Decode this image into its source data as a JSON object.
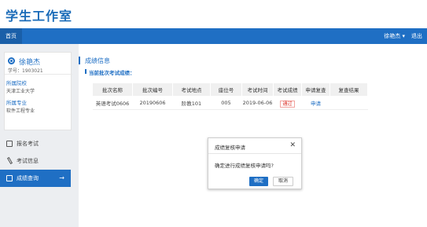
{
  "app": {
    "title": "学生工作室"
  },
  "nav": {
    "home": "首页",
    "user": "徐艳杰 ▾",
    "logout": "退出"
  },
  "profile": {
    "name": "徐艳杰",
    "student_id": "学号：1903021",
    "school_label": "所属院校",
    "school": "天津工业大学",
    "major_label": "所属专业",
    "major": "软件工程专业"
  },
  "menu": [
    {
      "label": "报名考试",
      "icon": "register-icon"
    },
    {
      "label": "考试信息",
      "icon": "edit-icon"
    },
    {
      "label": "成绩查询",
      "icon": "query-icon",
      "arrow": "→"
    }
  ],
  "main": {
    "section_title": "成绩信息",
    "sub_title": "当前批次考试成绩："
  },
  "table": {
    "headers": [
      "批次名称",
      "批次编号",
      "考试地点",
      "座位号",
      "考试时间",
      "考试成绩",
      "申请复查",
      "复查结果"
    ],
    "rows": [
      [
        "英语考试0606",
        "20190606",
        "阶教101",
        "005",
        "2019-06-06",
        "通过",
        "申请",
        ""
      ]
    ]
  },
  "modal": {
    "title": "成绩复核申请",
    "close": "✕",
    "message": "确定进行成绩复核申请吗?",
    "ok": "确定",
    "cancel": "取消"
  },
  "colors": {
    "primary": "#1f6fc4",
    "danger": "#d9261c"
  }
}
